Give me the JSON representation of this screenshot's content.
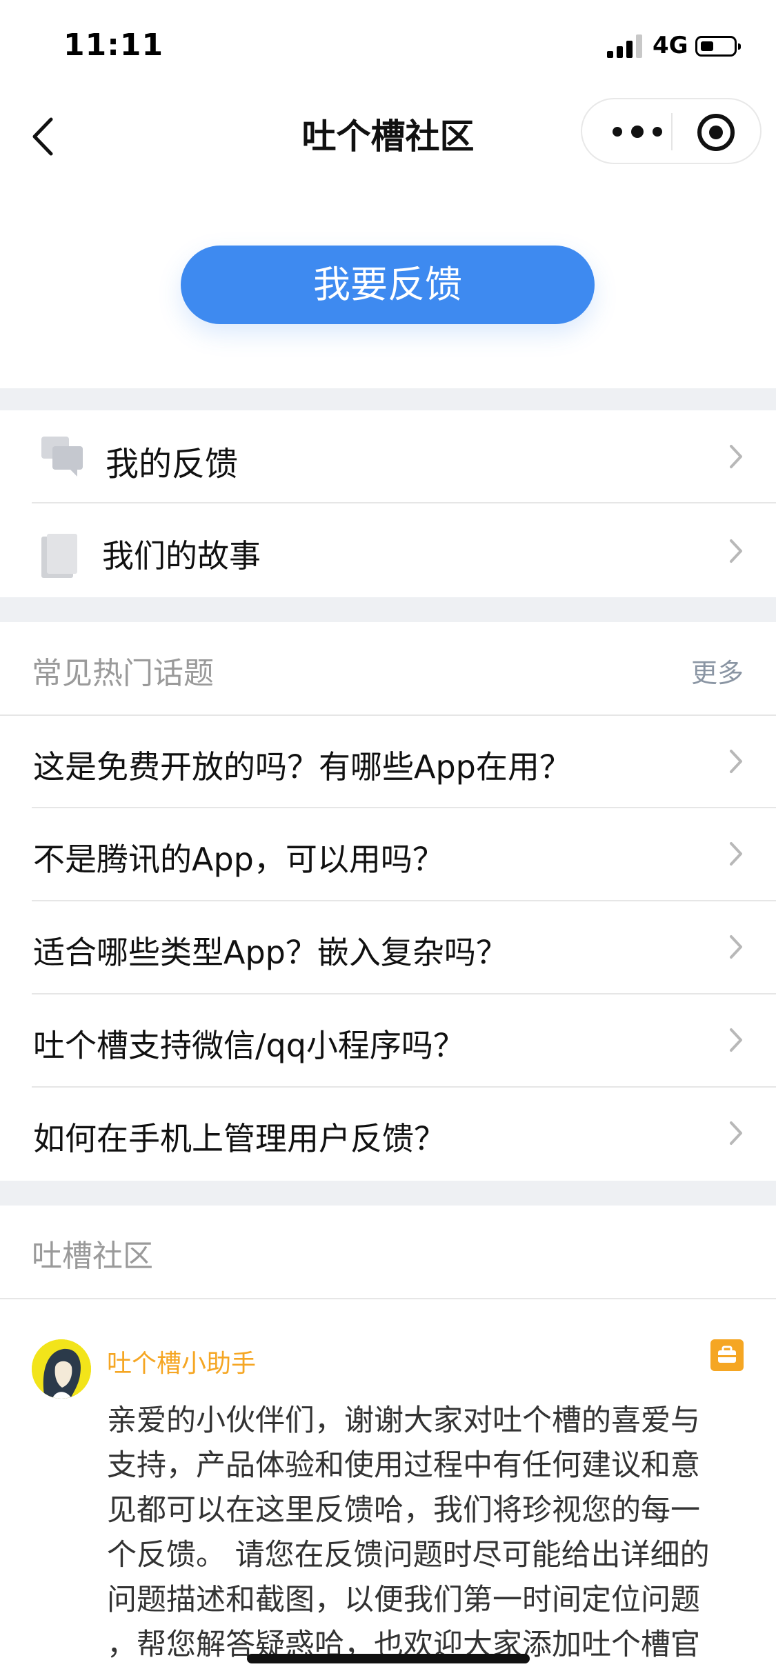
{
  "status_bar": {
    "time": "11:11",
    "network": "4G"
  },
  "nav": {
    "title": "吐个槽社区"
  },
  "feedback_button": {
    "label": "我要反馈"
  },
  "menu": [
    {
      "label": "我的反馈",
      "icon": "chat-bubbles-icon"
    },
    {
      "label": "我们的故事",
      "icon": "book-icon"
    }
  ],
  "hot_topics": {
    "header": "常见热门话题",
    "more": "更多",
    "items": [
      "这是免费开放的吗？有哪些App在用？",
      "不是腾讯的App，可以用吗？",
      "适合哪些类型App？嵌入复杂吗？",
      "吐个槽支持微信/qq小程序吗？",
      "如何在手机上管理用户反馈？"
    ]
  },
  "community": {
    "header": "吐槽社区",
    "post": {
      "author": "吐个槽小助手",
      "badge_icon": "briefcase-icon",
      "lines": [
        "亲爱的小伙伴们，谢谢大家对吐个槽的喜爱与",
        "支持，产品体验和使用过程中有任何建议和意",
        "见都可以在这里反馈哈，我们将珍视您的每一",
        "个反馈。 请您在反馈问题时尽可能给出详细的",
        "问题描述和截图，以便我们第一时间定位问题",
        "，帮您解答疑惑哈，也欢迎大家添加吐个槽官"
      ]
    }
  },
  "colors": {
    "accent": "#3e8af0",
    "author": "#f5a623",
    "band": "#eef0f3"
  }
}
